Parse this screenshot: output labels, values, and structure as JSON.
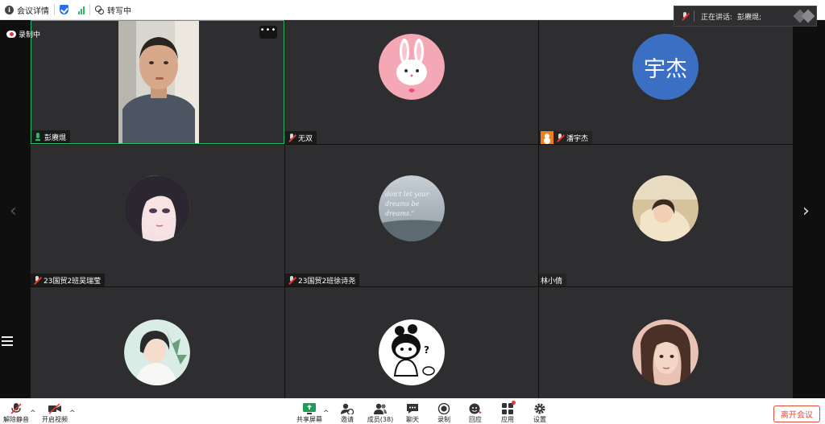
{
  "topbar": {
    "meeting_details": "会议详情",
    "transcribing": "转写中"
  },
  "speaking": {
    "label": "正在讲话:",
    "name": "彭赓焜;"
  },
  "recording": {
    "label": "录制中"
  },
  "participants": [
    {
      "name": "彭赓焜",
      "muted": false,
      "video_on": true,
      "active_speaker": true
    },
    {
      "name": "无双",
      "muted": true
    },
    {
      "name": "潘宇杰",
      "muted": true,
      "host": true,
      "avatar_text": "宇杰",
      "avatar_color": "#3b6fc4"
    },
    {
      "name": "23国贸2班吴瑞莹",
      "muted": true
    },
    {
      "name": "23国贸2班徐诗尧",
      "muted": true,
      "avatar_text": "don't let your dreams be dreams.\""
    },
    {
      "name": "林小倩",
      "muted": false
    },
    {
      "name": "",
      "muted": true
    },
    {
      "name": "",
      "muted": true
    },
    {
      "name": "",
      "muted": true
    }
  ],
  "tile_more": "•••",
  "toolbar": {
    "unmute": "解除静音",
    "start_video": "开启视频",
    "share_screen": "共享屏幕",
    "invite": "邀请",
    "members": "成员(38)",
    "chat": "聊天",
    "record": "录制",
    "react": "回应",
    "apps": "应用",
    "settings": "设置",
    "leave": "离开会议"
  },
  "colors": {
    "accent_green": "#1fc06b",
    "tile_bg": "#2e2e30",
    "leave_red": "#e24b3c",
    "host_orange": "#f0801e"
  }
}
